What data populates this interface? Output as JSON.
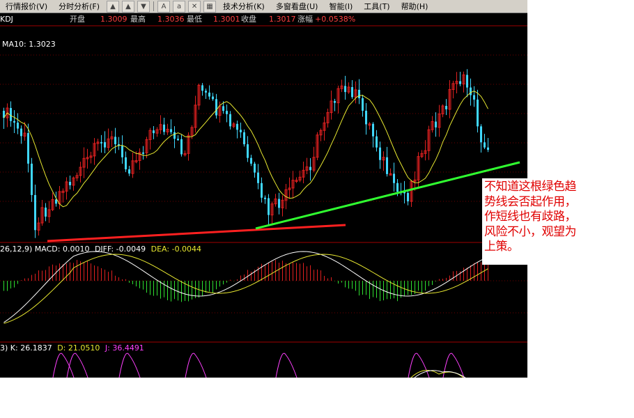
{
  "menu": {
    "items": [
      "行情报价(V)",
      "分时分析(F)",
      "技术分析(K)",
      "多窗看盘(U)",
      "智能(I)",
      "工具(T)",
      "帮助(H)"
    ],
    "toolbar_icons": [
      "up-arrow",
      "up-arrow",
      "down-arrow",
      "font-a",
      "font-a-small",
      "close-x",
      "grid"
    ]
  },
  "quote": {
    "indicator": "KDJ",
    "open_label": "开盘",
    "open_value": "1.3009",
    "high_label": "最高",
    "high_value": "1.3036",
    "low_label": "最低",
    "low_value": "1.3001",
    "close_label": "收盘",
    "close_value": "1.3017",
    "change_label": "涨幅",
    "change_value": "+0.0538%"
  },
  "main_panel": {
    "ma_label": "MA10: 1.3023"
  },
  "macd_panel": {
    "label": "26,12,9) MACD: 0.0010",
    "diff": "DIFF: -0.0049",
    "dea": "DEA: -0.0044"
  },
  "kdj_panel": {
    "label": "3) K: 26.1837",
    "d": "D: 21.0510",
    "j": "J: 36.4491"
  },
  "annotation": {
    "text": "不知道这根绿色趋势线会否起作用，作短线也有歧路，风险不小，观望为上策。"
  },
  "colors": {
    "up": "#e02020",
    "down": "#40d8ff",
    "ma": "#e8e830",
    "green_trend": "#30ff30",
    "red_trend": "#ff2020",
    "k_line": "#ffffff",
    "d_line": "#e8e830",
    "j_line": "#ff40ff",
    "panel_border": "#a00000"
  }
}
